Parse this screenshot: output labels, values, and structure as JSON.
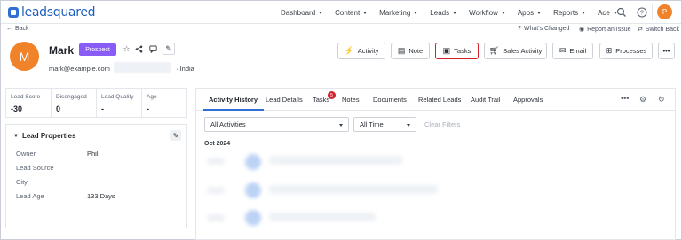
{
  "brand": {
    "name": "leadsquared",
    "accent": "#2f6fd6",
    "avatar_color": "#f0822a"
  },
  "topnav": {
    "menu": [
      {
        "label": "Dashboard"
      },
      {
        "label": "Content"
      },
      {
        "label": "Marketing"
      },
      {
        "label": "Leads"
      },
      {
        "label": "Workflow"
      },
      {
        "label": "Apps"
      },
      {
        "label": "Reports"
      },
      {
        "label": "Ace"
      }
    ],
    "search_icon": "search-icon",
    "help_icon": "help-icon",
    "user_initial": "P"
  },
  "backbar": {
    "back_label": "Back",
    "whats_changed": "What's Changed",
    "report_issue": "Report an Issue",
    "switch_back": "Switch Back"
  },
  "lead": {
    "initial": "M",
    "name": "Mark",
    "stage": "Prospect",
    "stage_color": "#8a5cf6",
    "email": "mark@example.com",
    "country": "India"
  },
  "actions": {
    "activity": "Activity",
    "note": "Note",
    "tasks": "Tasks",
    "sales_activity": "Sales Activity",
    "email": "Email",
    "processes": "Processes",
    "more": "•••",
    "highlight_color": "#d3212c"
  },
  "metrics": [
    {
      "label": "Lead Score",
      "value": "-30"
    },
    {
      "label": "Disengaged",
      "value": "0"
    },
    {
      "label": "Lead Quality",
      "value": "-"
    },
    {
      "label": "Age",
      "value": "-"
    }
  ],
  "lead_properties": {
    "title": "Lead Properties",
    "rows": [
      {
        "label": "Owner",
        "value": "Phil"
      },
      {
        "label": "Lead Source",
        "value": ""
      },
      {
        "label": "City",
        "value": ""
      },
      {
        "label": "Lead Age",
        "value": "133 Days"
      }
    ]
  },
  "tabs": {
    "items": [
      {
        "label": "Activity History"
      },
      {
        "label": "Lead Details"
      },
      {
        "label": "Tasks"
      },
      {
        "label": "Notes"
      },
      {
        "label": "Documents"
      },
      {
        "label": "Related Leads"
      },
      {
        "label": "Audit Trail"
      },
      {
        "label": "Approvals"
      }
    ],
    "tasks_badge": "5",
    "more": "•••"
  },
  "filters": {
    "activity_type": "All Activities",
    "time_range": "All Time",
    "clear_label": "Clear Filters"
  },
  "timeline": {
    "month_label": "Oct 2024"
  }
}
